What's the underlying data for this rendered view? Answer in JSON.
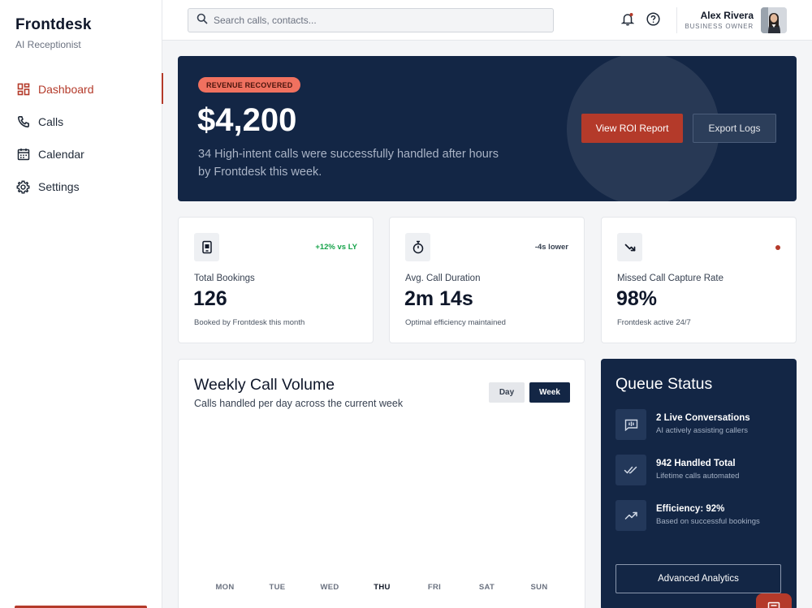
{
  "brand": {
    "name": "Frontdesk",
    "subtitle": "AI Receptionist"
  },
  "nav": [
    {
      "label": "Dashboard",
      "icon": "dashboard-icon",
      "active": true
    },
    {
      "label": "Calls",
      "icon": "phone-icon",
      "active": false
    },
    {
      "label": "Calendar",
      "icon": "calendar-icon",
      "active": false
    },
    {
      "label": "Settings",
      "icon": "gear-icon",
      "active": false
    }
  ],
  "header": {
    "search_placeholder": "Search calls, contacts...",
    "user_name": "Alex Rivera",
    "user_role": "BUSINESS OWNER"
  },
  "hero": {
    "badge": "REVENUE RECOVERED",
    "amount": "$4,200",
    "description": "34 High-intent calls were successfully handled after hours by Frontdesk this week.",
    "primary_button": "View ROI Report",
    "secondary_button": "Export Logs"
  },
  "stats": [
    {
      "icon": "booking-icon",
      "delta": "+12% vs LY",
      "delta_color": "#16a34a",
      "label": "Total Bookings",
      "value": "126",
      "sub": "Booked by Frontdesk this month"
    },
    {
      "icon": "timer-icon",
      "delta": "-4s lower",
      "delta_color": "#374151",
      "label": "Avg. Call Duration",
      "value": "2m 14s",
      "sub": "Optimal efficiency maintained"
    },
    {
      "icon": "missed-call-icon",
      "delta": "",
      "delta_color": "#b43a2a",
      "label": "Missed Call Capture Rate",
      "value": "98%",
      "sub": "Frontdesk active 24/7"
    }
  ],
  "weekly": {
    "title": "Weekly Call Volume",
    "subtitle": "Calls handled per day across the current week",
    "toggle": {
      "day": "Day",
      "week": "Week",
      "selected": "Week"
    },
    "days": [
      "MON",
      "TUE",
      "WED",
      "THU",
      "FRI",
      "SAT",
      "SUN"
    ],
    "current_day": "THU"
  },
  "queue": {
    "title": "Queue Status",
    "items": [
      {
        "icon": "live-chat-icon",
        "title": "2 Live Conversations",
        "sub": "AI actively assisting callers"
      },
      {
        "icon": "double-check-icon",
        "title": "942 Handled Total",
        "sub": "Lifetime calls automated"
      },
      {
        "icon": "trend-up-icon",
        "title": "Efficiency: 92%",
        "sub": "Based on successful bookings"
      }
    ],
    "button": "Advanced Analytics"
  },
  "colors": {
    "navy": "#132645",
    "accent": "#b43a2a",
    "badge": "#f0715f",
    "positive": "#16a34a"
  }
}
